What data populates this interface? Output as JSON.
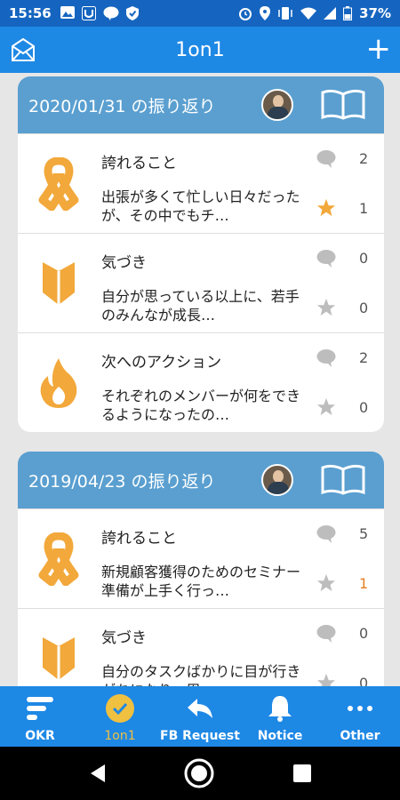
{
  "status": {
    "time": "15:56",
    "battery": "37%",
    "left_icons": [
      "image-icon",
      "u-app-icon",
      "line-chat-icon",
      "shield-icon"
    ],
    "right_icons": [
      "alarm-icon",
      "location-icon",
      "vibrate-icon",
      "wifi-icon",
      "signal-icon",
      "battery-icon"
    ]
  },
  "app_bar": {
    "title": "1on1",
    "left_icon": "mail-icon",
    "right_icon": "+"
  },
  "cards": [
    {
      "header": "2020/01/31 の振り返り",
      "rows": [
        {
          "icon": "ribbon-icon",
          "title": "誇れること",
          "text": "出張が多くて忙しい日々だったが、その中でもチ…",
          "comments": "2",
          "likes": "1",
          "starred": true
        },
        {
          "icon": "beginner-mark-icon",
          "title": "気づき",
          "text": "自分が思っている以上に、若手のみんなが成長…",
          "comments": "0",
          "likes": "0",
          "starred": false
        },
        {
          "icon": "flame-icon",
          "title": "次へのアクション",
          "text": "それぞれのメンバーが何をできるようになったの…",
          "comments": "2",
          "likes": "0",
          "starred": false
        }
      ]
    },
    {
      "header": "2019/04/23 の振り返り",
      "rows": [
        {
          "icon": "ribbon-icon",
          "title": "誇れること",
          "text": "新規顧客獲得のためのセミナー準備が上手く行っ…",
          "comments": "5",
          "likes": "1",
          "starred": false
        },
        {
          "icon": "beginner-mark-icon",
          "title": "気づき",
          "text": "自分のタスクばかりに目が行きがちになり、周…",
          "comments": "0",
          "likes": "0",
          "starred": false
        }
      ]
    }
  ],
  "nav": [
    {
      "label": "OKR",
      "icon": "okr-icon"
    },
    {
      "label": "1on1",
      "icon": "check-circle-icon",
      "active": true
    },
    {
      "label": "FB Request",
      "icon": "reply-icon"
    },
    {
      "label": "Notice",
      "icon": "bell-icon"
    },
    {
      "label": "Other",
      "icon": "more-icon"
    }
  ],
  "colors": {
    "status_bar": "#1565c0",
    "app_bar": "#1e88e5",
    "card_header": "#5a9fd0",
    "accent_orange": "#f2a83a",
    "active_nav": "#f0c040"
  }
}
